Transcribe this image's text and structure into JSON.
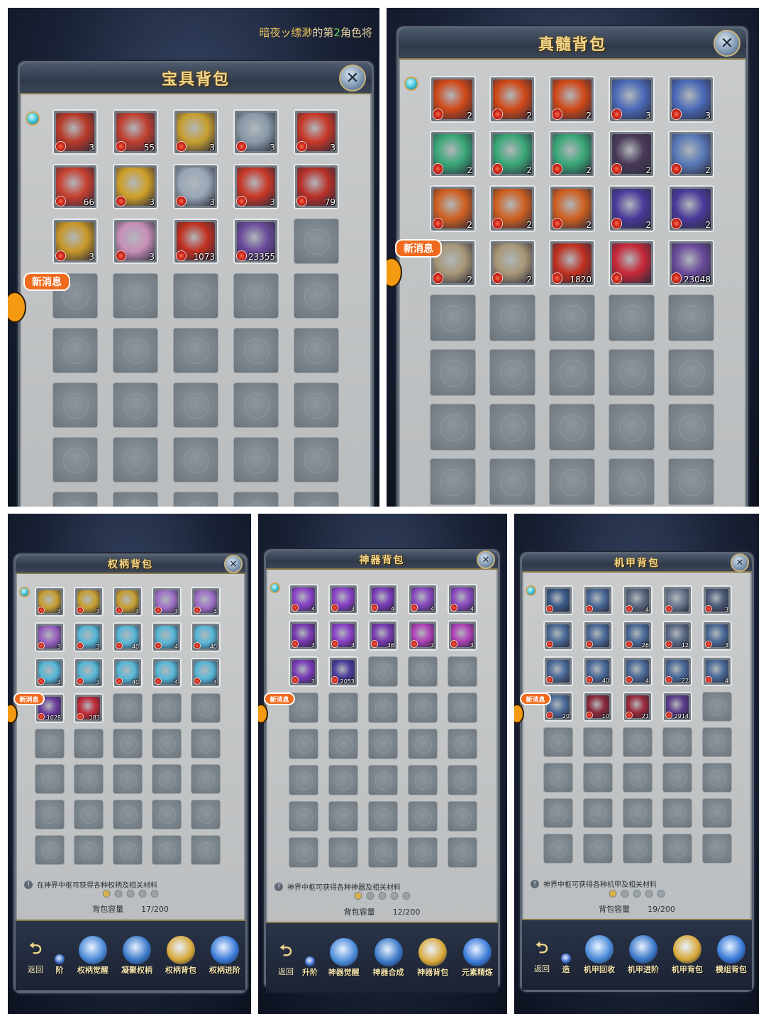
{
  "top_message": {
    "name": "暗夜ッ缥渺",
    "mid": "的第",
    "num": "2",
    "tail": "角色将"
  },
  "new_msg_label": "新消息",
  "return_label": "返回",
  "colors": {
    "title_gold": "#f3d68a",
    "badge_orange": "#f06a1e",
    "slot_gray": "#7e868e",
    "tag_green": "#3a9a3a"
  },
  "panels": [
    {
      "id": "treasure",
      "title": "宝具背包",
      "items": [
        {
          "icon": "red-gold-crown-icon",
          "color": "#b83a28",
          "count": "3"
        },
        {
          "icon": "red-gold-crown-icon",
          "color": "#c04030",
          "count": "55"
        },
        {
          "icon": "gold-crown-icon",
          "color": "#c8a030",
          "count": "3"
        },
        {
          "icon": "silver-crown-icon",
          "color": "#8a9aa8",
          "count": "3"
        },
        {
          "icon": "red-treasure-box-icon",
          "color": "#c83828",
          "count": "3"
        },
        {
          "icon": "red-seal-icon",
          "color": "#c84030",
          "count": "66"
        },
        {
          "icon": "gold-seal-icon",
          "color": "#d0a028",
          "count": "3"
        },
        {
          "icon": "silver-boot-icon",
          "color": "#9aa8b8",
          "count": "3"
        },
        {
          "icon": "red-banner-icon",
          "color": "#c83828",
          "count": "3"
        },
        {
          "icon": "red-banner-icon",
          "color": "#b83028",
          "count": "79"
        },
        {
          "icon": "gold-armor-icon",
          "color": "#c89828",
          "count": "3"
        },
        {
          "icon": "pink-shell-icon",
          "color": "#c890b8",
          "count": "3"
        },
        {
          "icon": "gold-crystal-icon",
          "color": "#c03020",
          "count": "1073"
        },
        {
          "icon": "silver-ingot-icon",
          "color": "#6a4a9a",
          "count": "23355"
        }
      ],
      "total_slots": 40
    },
    {
      "id": "true-marrow",
      "title": "真髓背包",
      "items": [
        {
          "icon": "fire-eye-icon",
          "color": "#d04818",
          "count": "2"
        },
        {
          "icon": "fire-eye-icon",
          "color": "#d04818",
          "count": "2"
        },
        {
          "icon": "fire-eye-icon",
          "color": "#d04818",
          "count": "2"
        },
        {
          "icon": "blue-claw-icon",
          "color": "#4a6ab8",
          "count": "3"
        },
        {
          "icon": "blue-claw-icon",
          "color": "#4a6ab8",
          "count": "3"
        },
        {
          "icon": "green-wing-icon",
          "color": "#3aa878",
          "count": "2"
        },
        {
          "icon": "green-wing-icon",
          "color": "#3aa878",
          "count": "2"
        },
        {
          "icon": "green-wing-icon",
          "color": "#3aa878",
          "count": "2"
        },
        {
          "icon": "dark-claw-icon",
          "color": "#4a3a58",
          "count": "2"
        },
        {
          "icon": "ice-claw-icon",
          "color": "#5a7ab8",
          "count": "2"
        },
        {
          "icon": "fire-box-icon",
          "color": "#d06020",
          "count": "2"
        },
        {
          "icon": "fire-box-icon",
          "color": "#d06020",
          "count": "2"
        },
        {
          "icon": "fire-box-icon",
          "color": "#d06020",
          "count": "2"
        },
        {
          "icon": "purple-claw-icon",
          "color": "#4a3a9a",
          "count": "2"
        },
        {
          "icon": "purple-claw-icon",
          "color": "#4a3a9a",
          "count": "2"
        },
        {
          "icon": "bone-horn-icon",
          "color": "#a89878",
          "count": "2"
        },
        {
          "icon": "bone-horn-icon",
          "color": "#a89878",
          "count": "2"
        },
        {
          "icon": "gold-molecule-icon",
          "color": "#c03020",
          "count": "1820"
        },
        {
          "icon": "red-crystal-icon",
          "color": "#c82838",
          "count": ""
        },
        {
          "icon": "silver-horn-icon",
          "color": "#6a4a9a",
          "count": "23048"
        }
      ],
      "total_slots": 40
    },
    {
      "id": "scepter",
      "title": "权柄背包",
      "items": [
        {
          "icon": "gold-orb-icon",
          "color": "#c8a030",
          "count": "3"
        },
        {
          "icon": "gold-orb-icon",
          "color": "#c8a030",
          "count": "3"
        },
        {
          "icon": "gold-orb-icon",
          "color": "#c8a030",
          "count": "3"
        },
        {
          "icon": "purple-cube-icon",
          "color": "#a070c8",
          "count": "3"
        },
        {
          "icon": "purple-cube-icon",
          "color": "#a070c8",
          "count": "3"
        },
        {
          "icon": "purple-gem-icon",
          "color": "#9860c0",
          "count": "3"
        },
        {
          "icon": "ice-crystal-icon",
          "color": "#58b8d8",
          "count": "3"
        },
        {
          "icon": "ice-crystal-icon",
          "color": "#58b8d8",
          "count": "40"
        },
        {
          "icon": "ice-crystal-icon",
          "color": "#58b8d8",
          "count": "4"
        },
        {
          "icon": "ice-crystal-icon",
          "color": "#58b8d8",
          "count": "40"
        },
        {
          "icon": "ice-crystal-icon",
          "color": "#58b8d8",
          "count": "3"
        },
        {
          "icon": "ice-crystal-icon",
          "color": "#58b8d8",
          "count": "3"
        },
        {
          "icon": "ice-crystal-icon",
          "color": "#58b8d8",
          "count": "40"
        },
        {
          "icon": "ice-crystal-icon",
          "color": "#58b8d8",
          "count": "4"
        },
        {
          "icon": "ice-crystal-icon",
          "color": "#58b8d8",
          "count": "4"
        },
        {
          "icon": "purple-cone-icon",
          "color": "#6a3a9a",
          "count": "1028"
        },
        {
          "icon": "pink-crystal-icon",
          "color": "#c02838",
          "count": "183"
        }
      ],
      "total_slots": 40,
      "tip": "在神界中枢可获得各种权柄及相关材料",
      "capacity_label": "背包容量",
      "capacity_value": "17/200",
      "nav": [
        "阶",
        "权柄觉醒",
        "凝聚权柄",
        "权柄背包",
        "权柄进阶"
      ]
    },
    {
      "id": "artifact",
      "title": "神器背包",
      "items": [
        {
          "icon": "purple-orb-icon",
          "color": "#8a40c8",
          "count": "4"
        },
        {
          "icon": "purple-orb-icon",
          "color": "#8a40c8",
          "count": "3"
        },
        {
          "icon": "purple-wing-icon",
          "color": "#7a3ab8",
          "count": "4"
        },
        {
          "icon": "purple-staff-icon",
          "color": "#8a48c0",
          "count": "4"
        },
        {
          "icon": "purple-staff-icon",
          "color": "#8a48c0",
          "count": "4"
        },
        {
          "icon": "purple-helm-icon",
          "color": "#7838b0",
          "count": "3"
        },
        {
          "icon": "purple-orb-icon",
          "color": "#8a40c8",
          "count": "3"
        },
        {
          "icon": "purple-helm-icon",
          "color": "#7838b0",
          "count": "36"
        },
        {
          "icon": "purple-heart-icon",
          "color": "#b040b8",
          "count": "3"
        },
        {
          "icon": "purple-heart-icon",
          "color": "#b040b8",
          "count": "3"
        },
        {
          "icon": "purple-box-icon",
          "color": "#7a3ab8",
          "count": "3"
        },
        {
          "icon": "blue-spirit-icon",
          "color": "#4a3a9a",
          "count": "2053"
        }
      ],
      "total_slots": 40,
      "tip": "神界中枢可获得各种神器及相关材料",
      "capacity_label": "背包容量",
      "capacity_value": "12/200",
      "nav": [
        "升阶",
        "神器觉醒",
        "神器合成",
        "神器背包",
        "元素精炼"
      ]
    },
    {
      "id": "mech",
      "title": "机甲背包",
      "items": [
        {
          "icon": "gold-mech-core-icon",
          "color": "#3a5a88",
          "count": ""
        },
        {
          "icon": "blue-mech-arm-icon",
          "color": "#4a6a98",
          "count": ""
        },
        {
          "icon": "silver-mech-helm-icon",
          "color": "#5a6a80",
          "count": "4"
        },
        {
          "icon": "silver-mech-shield-icon",
          "color": "#6a7a90",
          "count": ""
        },
        {
          "icon": "mech-blades-icon",
          "color": "#4a5a78",
          "count": "3"
        },
        {
          "icon": "mech-arm-icon",
          "color": "#4a6a98",
          "count": ""
        },
        {
          "icon": "mech-arm-icon",
          "color": "#4a6a98",
          "count": ""
        },
        {
          "icon": "mech-arm-icon",
          "color": "#4a6a98",
          "count": "26"
        },
        {
          "icon": "gold-mech-helm-icon",
          "color": "#5a6a88",
          "count": "12"
        },
        {
          "icon": "mech-arm-icon",
          "color": "#4a6a98",
          "count": "3"
        },
        {
          "icon": "mech-leg-icon",
          "color": "#4a6a98",
          "count": ""
        },
        {
          "icon": "mech-leg-icon",
          "color": "#4a6a98",
          "count": "40"
        },
        {
          "icon": "mech-leg-icon",
          "color": "#4a6a98",
          "count": "4"
        },
        {
          "icon": "mech-leg-icon",
          "color": "#4a6a98",
          "count": "22"
        },
        {
          "icon": "mech-leg-icon",
          "color": "#4a6a98",
          "count": "4"
        },
        {
          "icon": "mech-claw-icon",
          "color": "#4a6a98",
          "count": "20"
        },
        {
          "icon": "purple-mech-box-icon",
          "color": "#8a2838",
          "count": "10"
        },
        {
          "icon": "silver-mech-crystal-icon",
          "color": "#9a2838",
          "count": "21"
        },
        {
          "icon": "gold-gear-icon",
          "color": "#5a3a8a",
          "count": "2914"
        }
      ],
      "total_slots": 40,
      "tip": "神界中枢可获得各种机甲及相关材料",
      "capacity_label": "背包容量",
      "capacity_value": "19/200",
      "nav": [
        "造",
        "机甲回收",
        "机甲进阶",
        "机甲背包",
        "模组背包"
      ]
    }
  ]
}
